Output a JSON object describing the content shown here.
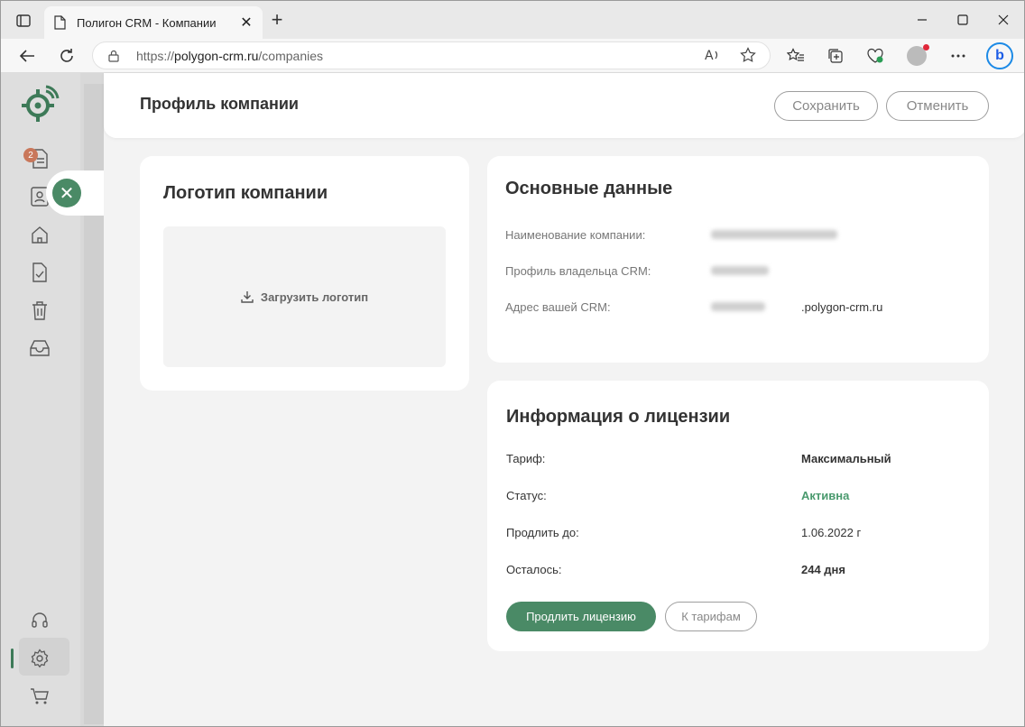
{
  "browser": {
    "tab_title": "Полигон CRM - Компании",
    "url_scheme": "https://",
    "url_host": "polygon-crm.ru",
    "url_path": "/companies"
  },
  "sidebar": {
    "badge_count": "2",
    "items": [
      "documents-icon",
      "contacts-icon",
      "home-icon",
      "tasks-icon",
      "trash-icon",
      "inbox-icon",
      "support-icon",
      "settings-icon",
      "cart-icon"
    ]
  },
  "header": {
    "title": "Профиль компании",
    "save_label": "Сохранить",
    "cancel_label": "Отменить"
  },
  "logo_card": {
    "title": "Логотип компании",
    "upload_label": "Загрузить логотип"
  },
  "main_data": {
    "title": "Основные данные",
    "company_name_label": "Наименование компании:",
    "owner_label": "Профиль владельца CRM:",
    "address_label": "Адрес вашей CRM:",
    "address_suffix": ".polygon-crm.ru"
  },
  "license": {
    "title": "Информация о лицензии",
    "tariff_label": "Тариф:",
    "tariff_value": "Максимальный",
    "status_label": "Статус:",
    "status_value": "Активна",
    "renew_until_label": "Продлить до:",
    "renew_until_value": "1.06.2022 г",
    "remaining_label": "Осталось:",
    "remaining_value": "244 дня",
    "renew_button": "Продлить лицензию",
    "tariffs_button": "К тарифам"
  },
  "colors": {
    "accent": "#4a8a66",
    "status_active": "#4a9a6e"
  }
}
